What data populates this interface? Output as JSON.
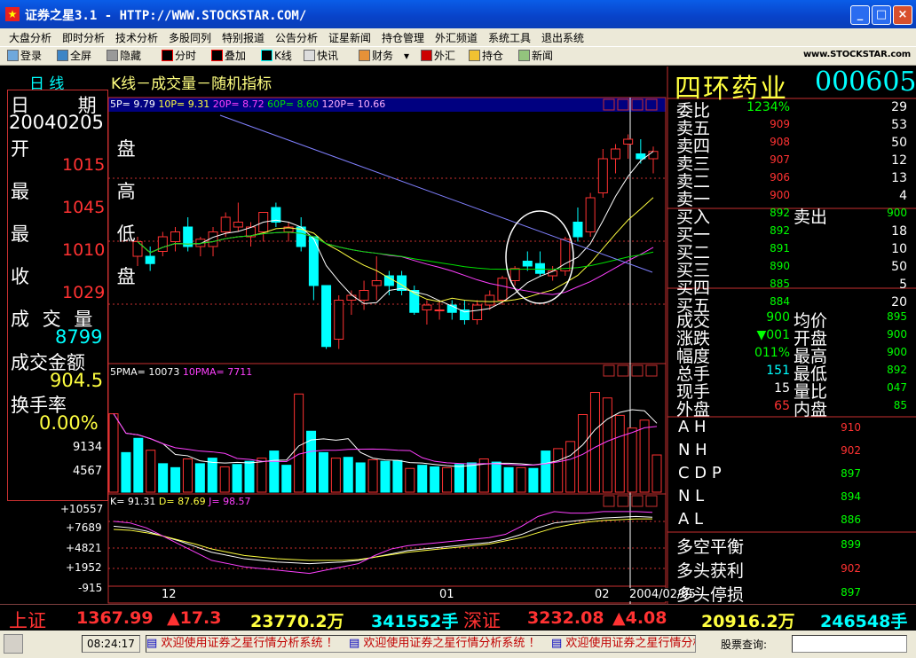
{
  "window": {
    "title": "证券之星3.1 - HTTP://WWW.STOCKSTAR.COM/",
    "min": "_",
    "max": "□",
    "close": "×"
  },
  "menu": [
    "大盘分析",
    "即时分析",
    "技术分析",
    "多股同列",
    "特别报道",
    "公告分析",
    "证星新闻",
    "持仓管理",
    "外汇频道",
    "系统工具",
    "退出系统"
  ],
  "toolbar": {
    "items": [
      "登录",
      "全屏",
      "隐藏",
      "分时",
      "叠加",
      "K线",
      "快讯",
      "财务",
      "外汇",
      "持仓",
      "新闻"
    ],
    "dropdown": "▾",
    "logo": "www.STOCKSTAR.com"
  },
  "chart_header": {
    "period": "日 线",
    "title": "K线－成交量－随机指标"
  },
  "ma": {
    "p5": "5P=",
    "v5": "9.79",
    "p10": "10P=",
    "v10": "9.31",
    "p20": "20P=",
    "v20": "8.72",
    "p60": "60P=",
    "v60": "8.60",
    "p120": "120P=",
    "v120": "10.66"
  },
  "vol": {
    "p5": "5PMA=",
    "v5": "10073",
    "p10": "10PMA=",
    "v10": "7711",
    "y1": "9134",
    "y2": "4567"
  },
  "kdj": {
    "k": "K= 91.31",
    "d": "D= 87.69",
    "j": "J= 98.57",
    "y": [
      "+10557",
      "+7689",
      "+4821",
      "+1952",
      "-915"
    ]
  },
  "xaxis": [
    "12",
    "01",
    "02"
  ],
  "cursor_date": "2004/02/05",
  "info": {
    "date_label": "日 期",
    "date": "20040205",
    "open_label": "开 盘",
    "open": "1015",
    "high_label": "最 高",
    "high": "1045",
    "low_label": "最 低",
    "low": "1010",
    "close_label": "收 盘",
    "close": "1029",
    "vol_label": "成 交 量",
    "vol": "8799",
    "amt_label": "成交金额",
    "amt": "904.5",
    "turn_label": "换手率",
    "turn": "0.00%"
  },
  "stock": {
    "name": "四环药业",
    "code": "000605"
  },
  "orderbook": {
    "weibi_label": "委比",
    "weibi": "1234%",
    "weibi_v": "29",
    "sell": [
      {
        "l": "卖五",
        "p": "909",
        "v": "53"
      },
      {
        "l": "卖四",
        "p": "908",
        "v": "50"
      },
      {
        "l": "卖三",
        "p": "907",
        "v": "12"
      },
      {
        "l": "卖二",
        "p": "906",
        "v": "13"
      },
      {
        "l": "卖一",
        "p": "900",
        "v": "4"
      }
    ],
    "buyin": {
      "l": "买入",
      "p": "892",
      "l2": "卖出",
      "p2": "900"
    },
    "buy": [
      {
        "l": "买一",
        "p": "892",
        "v": "18"
      },
      {
        "l": "买二",
        "p": "891",
        "v": "10"
      },
      {
        "l": "买三",
        "p": "890",
        "v": "50"
      },
      {
        "l": "买四",
        "p": "885",
        "v": "5"
      },
      {
        "l": "买五",
        "p": "884",
        "v": "20"
      }
    ],
    "stats": [
      {
        "l": "成交",
        "v": "900",
        "l2": "均价",
        "v2": "895"
      },
      {
        "l": "涨跌",
        "v": "▼001",
        "l2": "开盘",
        "v2": "900"
      },
      {
        "l": "幅度",
        "v": "011%",
        "l2": "最高",
        "v2": "900"
      },
      {
        "l": "总手",
        "v": "151",
        "l2": "最低",
        "v2": "892"
      },
      {
        "l": "现手",
        "v": "15",
        "l2": "量比",
        "v2": "047"
      },
      {
        "l": "外盘",
        "v": "65",
        "l2": "内盘",
        "v2": "85"
      }
    ],
    "indices": [
      {
        "l": "A H",
        "v": "910"
      },
      {
        "l": "N H",
        "v": "902"
      },
      {
        "l": "C D P",
        "v": "897"
      },
      {
        "l": "N L",
        "v": "894"
      },
      {
        "l": "A L",
        "v": "886"
      }
    ],
    "signals": [
      {
        "l": "多空平衡",
        "v": "899"
      },
      {
        "l": "多头获利",
        "v": "902"
      },
      {
        "l": "多头停损",
        "v": "897"
      }
    ]
  },
  "market": {
    "sh_label": "上证",
    "sh_val": "1367.99",
    "sh_chg": "▲17.3",
    "sh_amt": "23770.2万",
    "sh_vol": "341552手",
    "sz_label": "深证",
    "sz_val": "3232.08",
    "sz_chg": "▲4.08",
    "sz_amt": "20916.2万",
    "sz_vol": "246548手"
  },
  "bottom": {
    "time": "08:24:17",
    "ticker": "欢迎使用证券之星行情分析系统 ！",
    "query_label": "股票查询:"
  },
  "colors": {
    "up": "#ff3232",
    "down": "#00ffff",
    "ma5": "#ffffff",
    "ma10": "#ffff40",
    "ma20": "#ff40ff",
    "ma60": "#00e000",
    "ma120": "#8080ff"
  },
  "chart_data": {
    "type": "candlestick",
    "x_ticks": [
      "12",
      "01",
      "02"
    ],
    "candles": [
      {
        "o": 9.2,
        "h": 9.6,
        "l": 9.0,
        "c": 9.5
      },
      {
        "o": 9.2,
        "h": 9.4,
        "l": 8.9,
        "c": 9.05
      },
      {
        "o": 9.3,
        "h": 9.7,
        "l": 9.2,
        "c": 9.6
      },
      {
        "o": 9.5,
        "h": 9.8,
        "l": 9.3,
        "c": 9.7
      },
      {
        "o": 9.8,
        "h": 10.0,
        "l": 9.3,
        "c": 9.4
      },
      {
        "o": 9.4,
        "h": 9.6,
        "l": 9.2,
        "c": 9.55
      },
      {
        "o": 9.4,
        "h": 9.8,
        "l": 9.2,
        "c": 9.7
      },
      {
        "o": 9.7,
        "h": 10.1,
        "l": 9.6,
        "c": 10.0
      },
      {
        "o": 9.8,
        "h": 10.3,
        "l": 9.7,
        "c": 9.9
      },
      {
        "o": 9.6,
        "h": 9.9,
        "l": 9.4,
        "c": 9.8
      },
      {
        "o": 9.7,
        "h": 10.1,
        "l": 9.5,
        "c": 10.1
      },
      {
        "o": 10.2,
        "h": 10.3,
        "l": 9.8,
        "c": 9.9
      },
      {
        "o": 9.7,
        "h": 9.9,
        "l": 9.5,
        "c": 9.8
      },
      {
        "o": 9.8,
        "h": 10.0,
        "l": 9.3,
        "c": 9.4
      },
      {
        "o": 9.6,
        "h": 9.6,
        "l": 8.3,
        "c": 8.6
      },
      {
        "o": 8.6,
        "h": 8.6,
        "l": 7.3,
        "c": 7.35
      },
      {
        "o": 7.5,
        "h": 8.4,
        "l": 7.3,
        "c": 8.3
      },
      {
        "o": 8.3,
        "h": 8.5,
        "l": 8.0,
        "c": 8.4
      },
      {
        "o": 8.3,
        "h": 8.7,
        "l": 8.1,
        "c": 8.5
      },
      {
        "o": 8.6,
        "h": 9.2,
        "l": 8.3,
        "c": 8.7
      },
      {
        "o": 8.8,
        "h": 8.9,
        "l": 8.4,
        "c": 8.6
      },
      {
        "o": 8.8,
        "h": 8.9,
        "l": 8.4,
        "c": 8.5
      },
      {
        "o": 8.5,
        "h": 8.6,
        "l": 8.0,
        "c": 8.05
      },
      {
        "o": 8.1,
        "h": 8.3,
        "l": 7.8,
        "c": 8.2
      },
      {
        "o": 8.1,
        "h": 8.3,
        "l": 7.9,
        "c": 8.1
      },
      {
        "o": 8.2,
        "h": 8.3,
        "l": 7.9,
        "c": 8.05
      },
      {
        "o": 8.1,
        "h": 8.3,
        "l": 7.8,
        "c": 7.9
      },
      {
        "o": 7.9,
        "h": 8.3,
        "l": 7.8,
        "c": 8.2
      },
      {
        "o": 8.2,
        "h": 8.5,
        "l": 8.1,
        "c": 8.4
      },
      {
        "o": 8.3,
        "h": 8.8,
        "l": 8.2,
        "c": 8.75
      },
      {
        "o": 8.7,
        "h": 9.0,
        "l": 8.6,
        "c": 8.95
      },
      {
        "o": 9.1,
        "h": 9.3,
        "l": 8.9,
        "c": 9.0
      },
      {
        "o": 9.05,
        "h": 9.3,
        "l": 8.8,
        "c": 8.85
      },
      {
        "o": 8.8,
        "h": 9.0,
        "l": 8.7,
        "c": 8.9
      },
      {
        "o": 8.9,
        "h": 9.6,
        "l": 8.8,
        "c": 9.55
      },
      {
        "o": 9.9,
        "h": 10.2,
        "l": 9.5,
        "c": 9.6
      },
      {
        "o": 9.7,
        "h": 10.5,
        "l": 9.6,
        "c": 10.4
      },
      {
        "o": 10.5,
        "h": 11.4,
        "l": 10.4,
        "c": 11.2
      },
      {
        "o": 11.2,
        "h": 11.5,
        "l": 10.9,
        "c": 11.4
      },
      {
        "o": 11.5,
        "h": 11.7,
        "l": 11.2,
        "c": 11.6
      },
      {
        "o": 11.3,
        "h": 11.6,
        "l": 11.1,
        "c": 11.2
      },
      {
        "o": 11.2,
        "h": 11.45,
        "l": 10.9,
        "c": 11.35
      }
    ],
    "volume": [
      9900,
      5000,
      6800,
      5300,
      3600,
      3100,
      4200,
      3600,
      4300,
      3200,
      3500,
      3900,
      4300,
      5200,
      3400,
      12400,
      7700,
      5000,
      4300,
      4400,
      3700,
      4100,
      3900,
      4000,
      3000,
      3400,
      3200,
      3100,
      3500,
      3700,
      4200,
      3800,
      3100,
      3100,
      3000,
      5200,
      5500,
      6400,
      9800,
      12600,
      11900,
      9700,
      8100,
      9100,
      4700
    ],
    "kdj": {
      "k": [
        80,
        78,
        74,
        68,
        62,
        55,
        48,
        44,
        40,
        38,
        36,
        35,
        34,
        35,
        36,
        38,
        42,
        46,
        50,
        52,
        54,
        56,
        58,
        60,
        64,
        70,
        78,
        84,
        86,
        88,
        90,
        91,
        92,
        91
      ],
      "d": [
        76,
        75,
        72,
        68,
        63,
        58,
        52,
        48,
        44,
        42,
        40,
        39,
        38,
        38,
        38,
        39,
        42,
        45,
        48,
        50,
        52,
        54,
        56,
        58,
        62,
        66,
        72,
        78,
        82,
        85,
        87,
        88,
        89,
        89
      ],
      "j": [
        86,
        84,
        78,
        68,
        58,
        48,
        38,
        34,
        30,
        28,
        26,
        24,
        22,
        26,
        30,
        34,
        44,
        52,
        56,
        58,
        60,
        62,
        64,
        66,
        70,
        80,
        92,
        98,
        96,
        96,
        98,
        98,
        98,
        97
      ]
    }
  }
}
